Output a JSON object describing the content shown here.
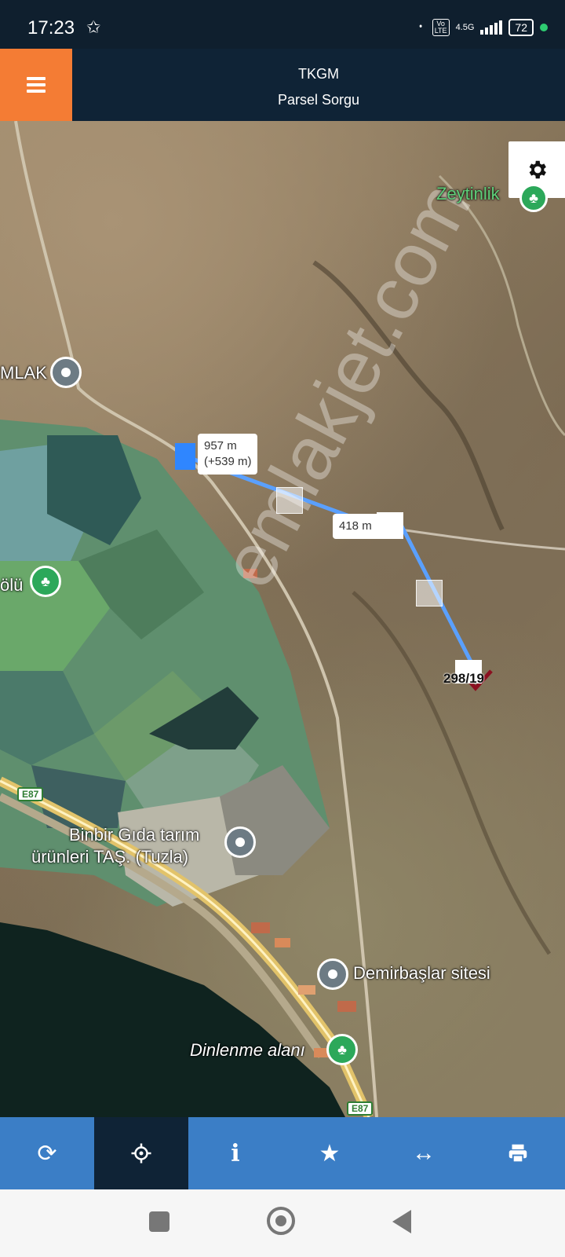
{
  "status": {
    "time": "17:23",
    "network": "4.5G",
    "battery": "72"
  },
  "header": {
    "title": "TKGM",
    "subtitle": "Parsel Sorgu"
  },
  "map": {
    "labels": {
      "zeytinlik": "Zeytinlik",
      "mlak": "MLAK",
      "golu": "ölü",
      "binbir_line1": "Binbir Gıda tarım",
      "binbir_line2": "ürünleri TAŞ. (Tuzla)",
      "demirbaslar": "Demirbaşlar sitesi",
      "dinlenme": "Dinlenme alanı",
      "road_e87": "E87",
      "watermark": "emlakjet.com"
    },
    "measure": {
      "total": "957 m",
      "added": "(+539 m)",
      "segment": "418 m"
    },
    "parcel": "298/19"
  },
  "toolbar": {
    "icons": [
      "refresh-icon",
      "crosshair-icon",
      "info-icon",
      "star-icon",
      "measure-icon",
      "print-icon"
    ],
    "active_index": 1
  }
}
